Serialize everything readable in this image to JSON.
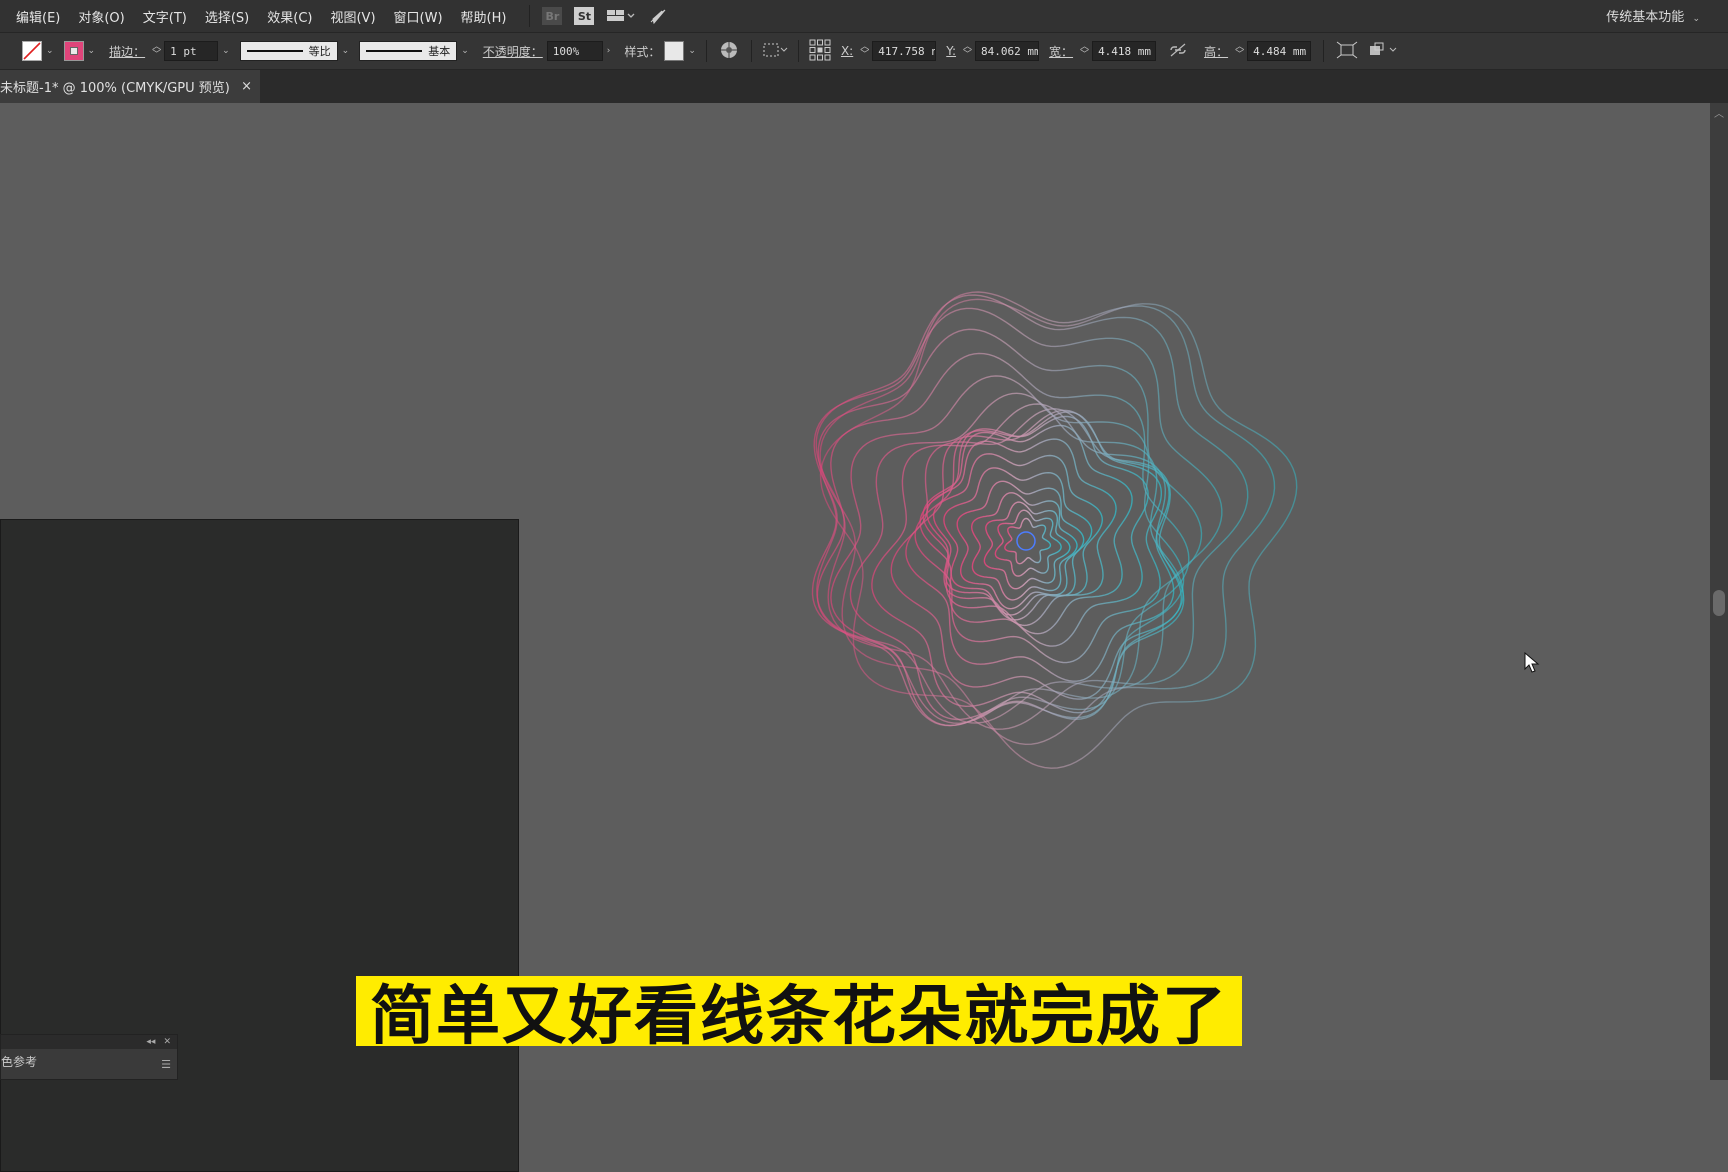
{
  "menubar": {
    "items": [
      "编辑(E)",
      "对象(O)",
      "文字(T)",
      "选择(S)",
      "效果(C)",
      "视图(V)",
      "窗口(W)",
      "帮助(H)"
    ],
    "bridge_label": "Br",
    "stock_label": "St",
    "workspace": "传统基本功能"
  },
  "controlbar": {
    "stroke_label": "描边：",
    "stroke_weight": "1 pt",
    "stroke_profile_label": "等比",
    "brush_label": "基本",
    "opacity_label": "不透明度：",
    "opacity_value": "100%",
    "style_label": "样式：",
    "x_label": "X:",
    "x_value": "417.758 n",
    "y_label": "Y:",
    "y_value": "84.062 mm",
    "w_label": "宽：",
    "w_value": "4.418 mm",
    "h_label": "高：",
    "h_value": "4.484 mm"
  },
  "document": {
    "tab_title": "未标题-1* @ 100% (CMYK/GPU 预览)",
    "close_glyph": "×"
  },
  "panel": {
    "title": "色参考"
  },
  "subtitle": "简单又好看线条花朵就完成了",
  "colors": {
    "flower_left": "#e0447a",
    "flower_right": "#33b7c4",
    "flower_top": "#c9a3b8",
    "subtitle_bg": "#ffec00"
  }
}
